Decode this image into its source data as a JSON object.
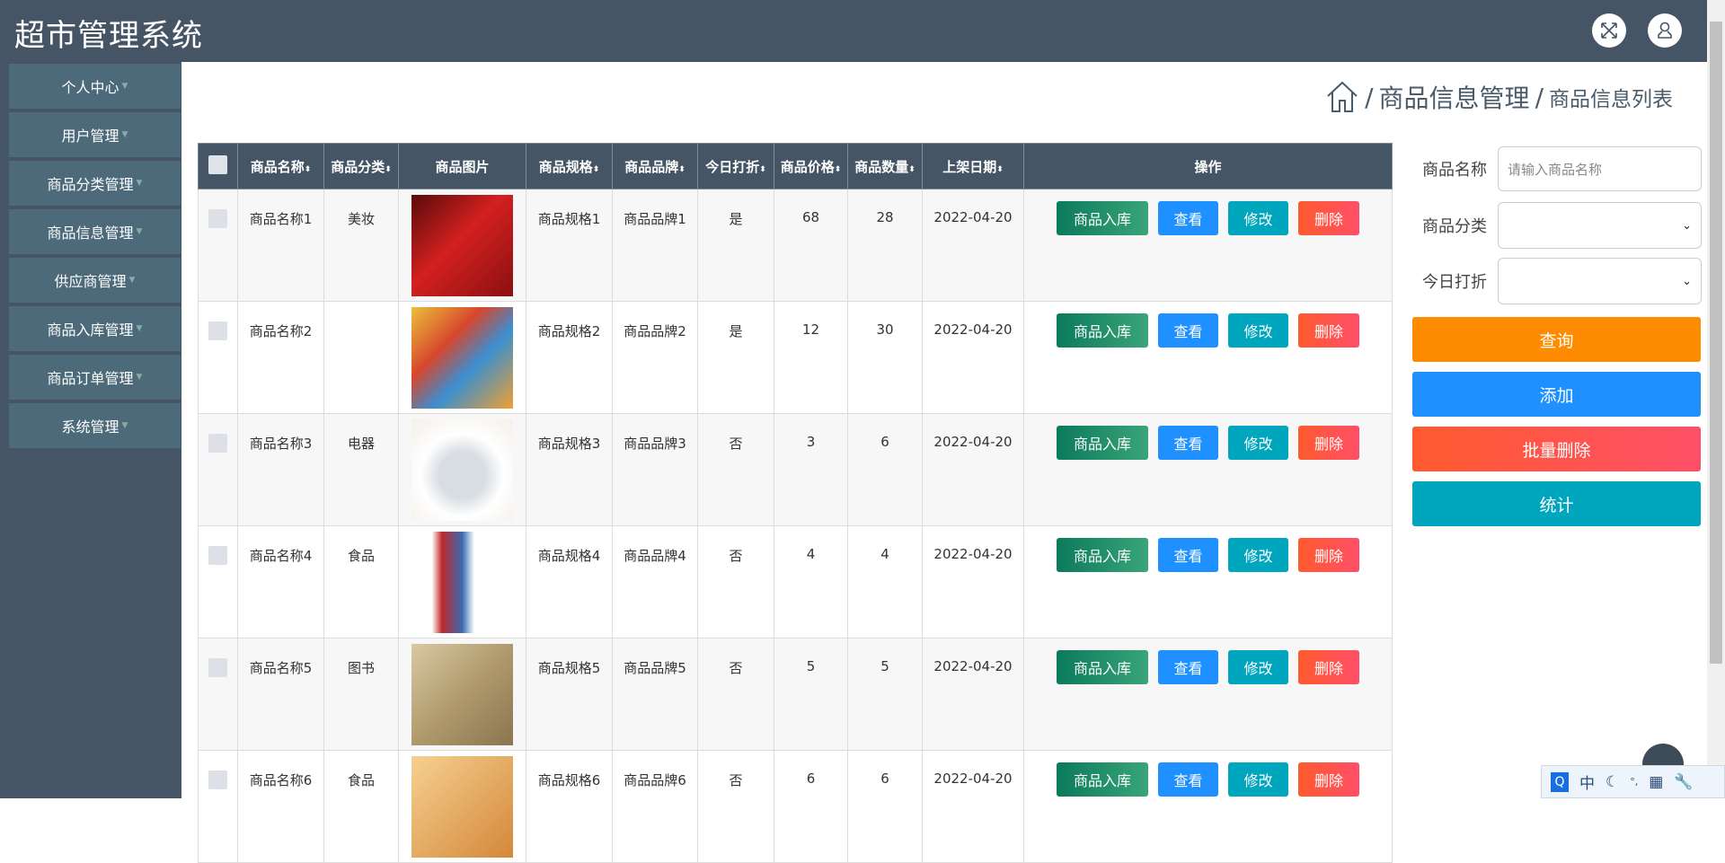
{
  "app": {
    "title": "超市管理系统"
  },
  "header_icons": [
    "fullscreen-icon",
    "user-icon"
  ],
  "sidebar": {
    "items": [
      {
        "label": "个人中心"
      },
      {
        "label": "用户管理"
      },
      {
        "label": "商品分类管理"
      },
      {
        "label": "商品信息管理"
      },
      {
        "label": "供应商管理"
      },
      {
        "label": "商品入库管理"
      },
      {
        "label": "商品订单管理"
      },
      {
        "label": "系统管理"
      }
    ]
  },
  "breadcrumb": {
    "level1": "商品信息管理",
    "level2": "商品信息列表",
    "sep": "/"
  },
  "table": {
    "headers": [
      "商品名称",
      "商品分类",
      "商品图片",
      "商品规格",
      "商品品牌",
      "今日打折",
      "商品价格",
      "商品数量",
      "上架日期",
      "操作"
    ],
    "sortable": [
      true,
      true,
      false,
      true,
      true,
      true,
      true,
      true,
      true,
      false
    ],
    "sort_glyph": "⬍",
    "actions": {
      "stock_in": "商品入库",
      "view": "查看",
      "edit": "修改",
      "delete": "删除"
    },
    "rows": [
      {
        "name": "商品名称1",
        "category": "美妆",
        "spec": "商品规格1",
        "brand": "商品品牌1",
        "discount": "是",
        "price": "68",
        "qty": "28",
        "date": "2022-04-20",
        "img": "linear-gradient(135deg,#5a0a0a,#d42020 45%,#8a1010)"
      },
      {
        "name": "商品名称2",
        "category": "",
        "spec": "商品规格2",
        "brand": "商品品牌2",
        "discount": "是",
        "price": "12",
        "qty": "30",
        "date": "2022-04-20",
        "img": "linear-gradient(135deg,#e9c13a,#d8462e 35%,#3a8fd0 60%,#f0a030)"
      },
      {
        "name": "商品名称3",
        "category": "电器",
        "spec": "商品规格3",
        "brand": "商品品牌3",
        "discount": "否",
        "price": "3",
        "qty": "6",
        "date": "2022-04-20",
        "img": "radial-gradient(circle at 50% 55%,#d8dde2 30%,#fff 55%,#f4efe8)"
      },
      {
        "name": "商品名称4",
        "category": "食品",
        "spec": "商品规格4",
        "brand": "商品品牌4",
        "discount": "否",
        "price": "4",
        "qty": "4",
        "date": "2022-04-20",
        "img": "linear-gradient(90deg,#fff 20%,#c0282a 30%,#3a6bb0 50%,#fff 62%)"
      },
      {
        "name": "商品名称5",
        "category": "图书",
        "spec": "商品规格5",
        "brand": "商品品牌5",
        "discount": "否",
        "price": "5",
        "qty": "5",
        "date": "2022-04-20",
        "img": "linear-gradient(135deg,#d8c8a4,#b09a6c 50%,#8a7550)"
      },
      {
        "name": "商品名称6",
        "category": "食品",
        "spec": "商品规格6",
        "brand": "商品品牌6",
        "discount": "否",
        "price": "6",
        "qty": "6",
        "date": "2022-04-20",
        "img": "linear-gradient(135deg,#f5d090,#d4883a)"
      }
    ]
  },
  "search": {
    "name_label": "商品名称",
    "name_placeholder": "请输入商品名称",
    "category_label": "商品分类",
    "category_value": "",
    "discount_label": "今日打折",
    "discount_value": ""
  },
  "buttons": {
    "query": "查询",
    "add": "添加",
    "batch_delete": "批量删除",
    "stats": "统计"
  },
  "ime": {
    "lang": "中"
  }
}
